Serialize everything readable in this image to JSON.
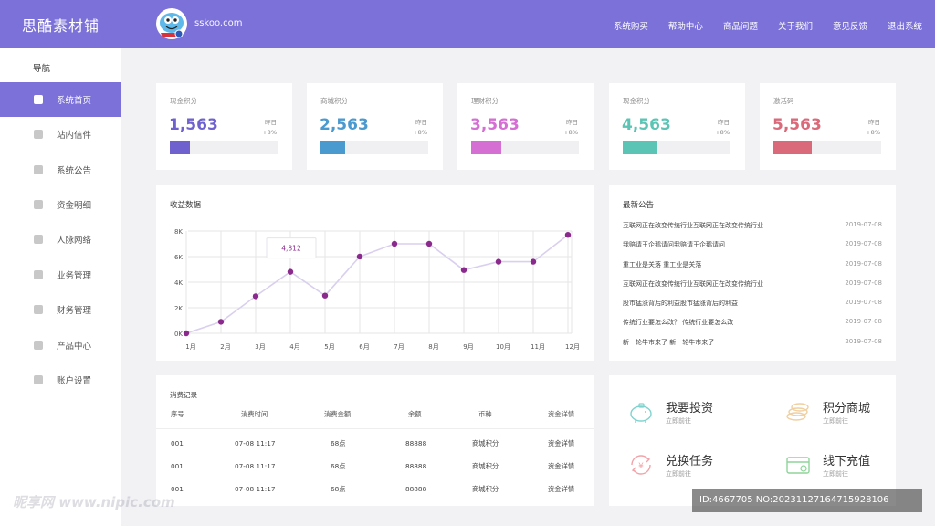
{
  "header": {
    "brand": "思酷素材铺",
    "site_url": "sskoo.com",
    "nav": [
      "系统购买",
      "帮助中心",
      "商品问题",
      "关于我们",
      "意见反馈",
      "退出系统"
    ]
  },
  "sidebar": {
    "title": "导航",
    "items": [
      {
        "label": "系统首页",
        "active": true
      },
      {
        "label": "站内信件"
      },
      {
        "label": "系统公告"
      },
      {
        "label": "资金明细"
      },
      {
        "label": "人脉网络"
      },
      {
        "label": "业务管理"
      },
      {
        "label": "财务管理"
      },
      {
        "label": "产品中心"
      },
      {
        "label": "账户设置"
      }
    ]
  },
  "stats": [
    {
      "label": "现金积分",
      "value": "1,563",
      "yesterday": "昨日",
      "change": "+8%",
      "color": "#6f62cf",
      "progress": 0.19
    },
    {
      "label": "商城积分",
      "value": "2,563",
      "yesterday": "昨日",
      "change": "+8%",
      "color": "#4a9ad0",
      "progress": 0.23
    },
    {
      "label": "理财积分",
      "value": "3,563",
      "yesterday": "昨日",
      "change": "+8%",
      "color": "#d56fd3",
      "progress": 0.28
    },
    {
      "label": "现金积分",
      "value": "4,563",
      "yesterday": "昨日",
      "change": "+8%",
      "color": "#5bc4b4",
      "progress": 0.31
    },
    {
      "label": "激活码",
      "value": "5,563",
      "yesterday": "昨日",
      "change": "+8%",
      "color": "#da6a7a",
      "progress": 0.36
    }
  ],
  "chart": {
    "title": "收益数据",
    "tooltip": "4,812"
  },
  "chart_data": {
    "type": "line",
    "title": "收益数据",
    "categories": [
      "1月",
      "2月",
      "3月",
      "4月",
      "5月",
      "6月",
      "7月",
      "8月",
      "9月",
      "10月",
      "11月",
      "12月"
    ],
    "values": [
      0,
      900,
      2900,
      4812,
      2950,
      6000,
      7000,
      7000,
      4950,
      5600,
      5600,
      7700
    ],
    "y_ticks": [
      "0K",
      "2K",
      "4K",
      "6K",
      "8K"
    ],
    "ylim": [
      0,
      8000
    ],
    "grid": true,
    "line_color": "#d9cfee",
    "point_color": "#8a2a8c"
  },
  "announcements": {
    "title": "最新公告",
    "items": [
      {
        "text": "互联网正在改变传统行业互联网正在改变传统行业",
        "date": "2019-07-08"
      },
      {
        "text": "我赔请王企鹅请问我赔请王企鹅请问",
        "date": "2019-07-08"
      },
      {
        "text": "重工业是关落 重工业是关落",
        "date": "2019-07-08"
      },
      {
        "text": "互联网正在改变传统行业互联网正在改变传统行业",
        "date": "2019-07-08"
      },
      {
        "text": "股市猛涨背后的利益股市猛涨背后的利益",
        "date": "2019-07-08"
      },
      {
        "text": "传统行业要怎么改？ 传统行业要怎么改",
        "date": "2019-07-08"
      },
      {
        "text": "新一轮牛市来了 新一轮牛市来了",
        "date": "2019-07-08"
      }
    ]
  },
  "consumption": {
    "title": "消费记录",
    "headers": [
      "序号",
      "消费时间",
      "消费金额",
      "余额",
      "币种",
      "资金详情"
    ],
    "rows": [
      [
        "001",
        "07-08  11:17",
        "68点",
        "88888",
        "商城积分",
        "资金详情"
      ],
      [
        "001",
        "07-08  11:17",
        "68点",
        "88888",
        "商城积分",
        "资金详情"
      ],
      [
        "001",
        "07-08  11:17",
        "68点",
        "88888",
        "商城积分",
        "资金详情"
      ]
    ]
  },
  "quick_actions": [
    {
      "title": "我要投资",
      "sub": "立即前往",
      "icon": "piggy-bank-icon"
    },
    {
      "title": "积分商城",
      "sub": "立即前往",
      "icon": "coins-icon"
    },
    {
      "title": "兑换任务",
      "sub": "立即前往",
      "icon": "exchange-icon"
    },
    {
      "title": "线下充值",
      "sub": "立即前往",
      "icon": "wallet-icon"
    }
  ],
  "watermark": {
    "left": "昵享网 www.nipic.com",
    "right": "ID:4667705 NO:20231127164715928106"
  }
}
